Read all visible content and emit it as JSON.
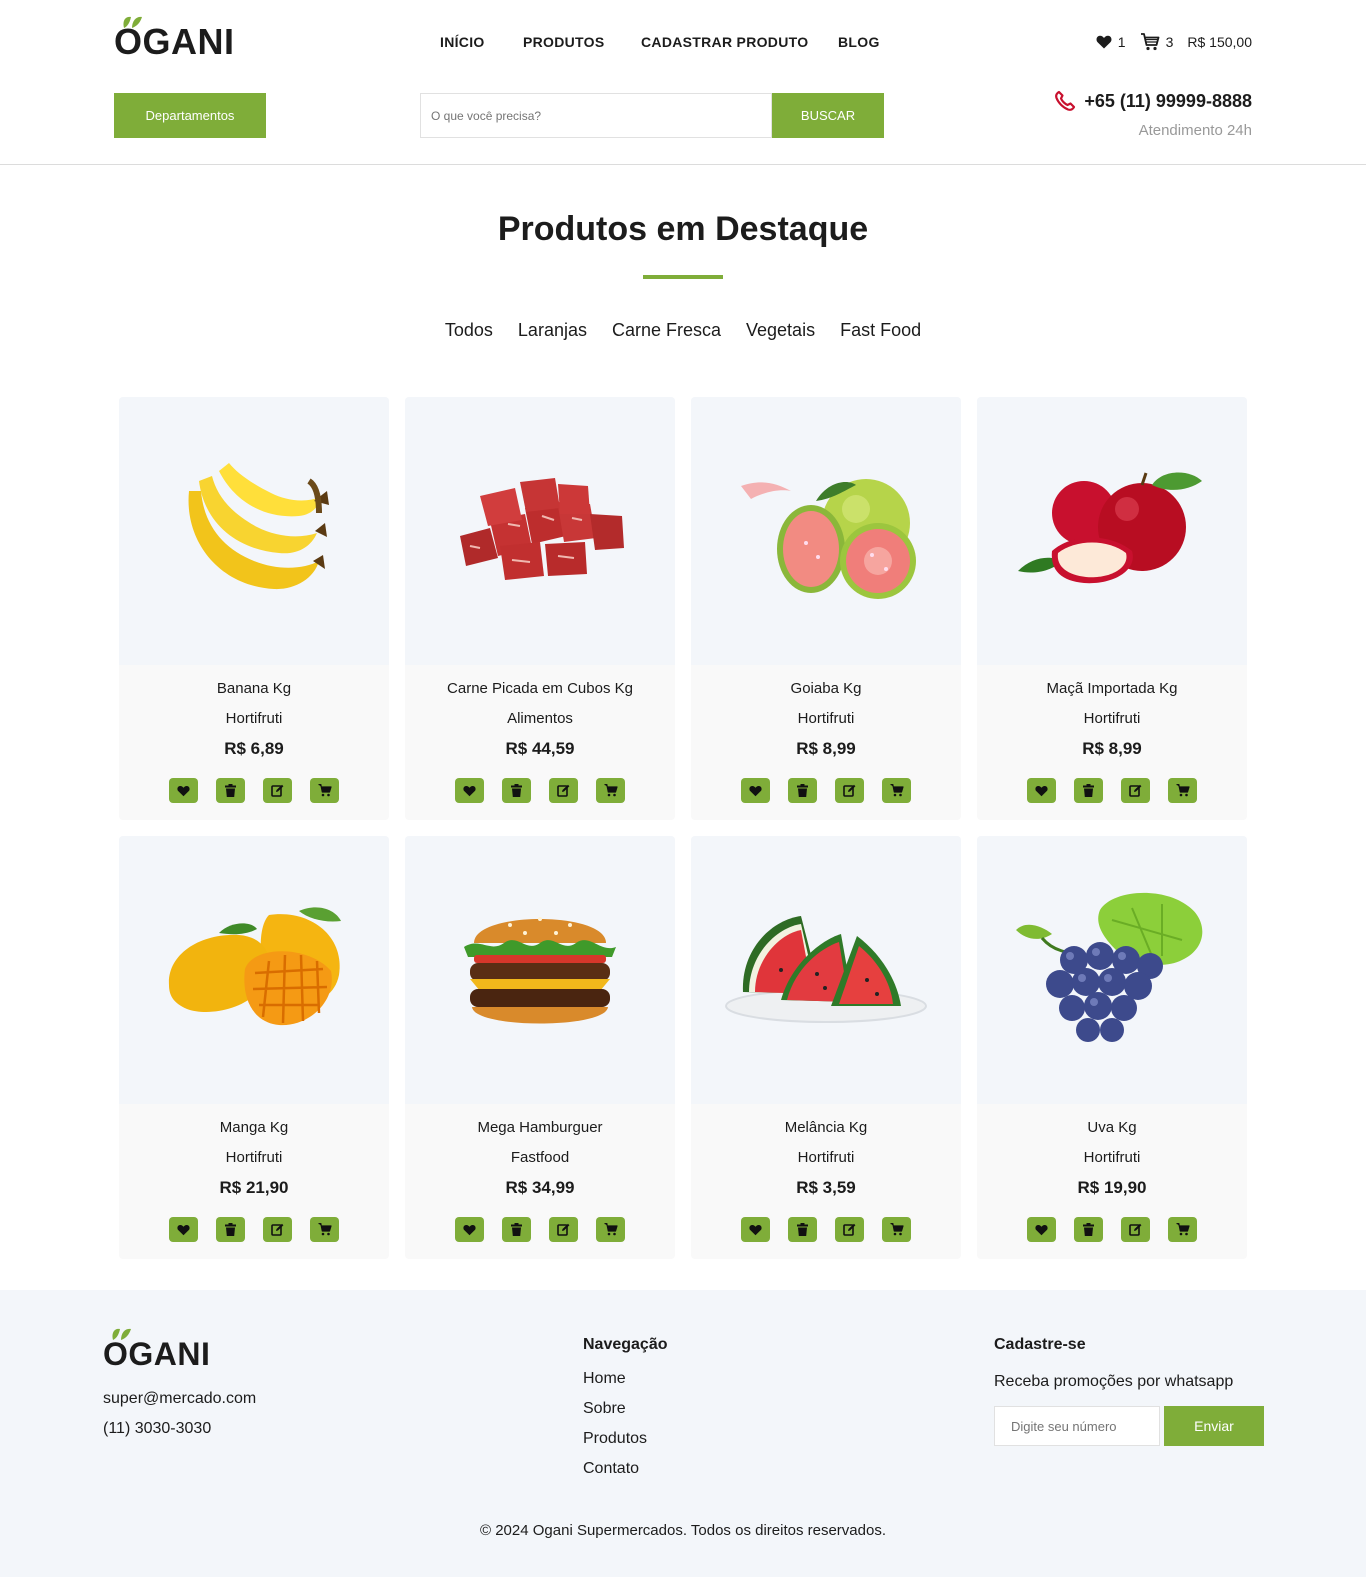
{
  "brand": {
    "name": "OGANI",
    "accent": "#7fad39"
  },
  "nav": [
    {
      "label": "INÍCIO"
    },
    {
      "label": "PRODUTOS"
    },
    {
      "label": "CADASTRAR PRODUTO"
    },
    {
      "label": "BLOG"
    }
  ],
  "header": {
    "wishlist_count": "1",
    "cart_count": "3",
    "cart_total": "R$ 150,00",
    "departments_label": "Departamentos",
    "search_placeholder": "O que você precisa?",
    "search_button": "BUSCAR",
    "phone": "+65 (11) 99999-8888",
    "phone_sub": "Atendimento 24h"
  },
  "featured": {
    "title": "Produtos em Destaque",
    "filters": [
      "Todos",
      "Laranjas",
      "Carne Fresca",
      "Vegetais",
      "Fast Food"
    ]
  },
  "products": [
    {
      "name": "Banana Kg",
      "category": "Hortifruti",
      "price": "R$ 6,89",
      "image": "banana"
    },
    {
      "name": "Carne Picada em Cubos Kg",
      "category": "Alimentos",
      "price": "R$ 44,59",
      "image": "beef-cubes"
    },
    {
      "name": "Goiaba Kg",
      "category": "Hortifruti",
      "price": "R$ 8,99",
      "image": "guava"
    },
    {
      "name": "Maçã Importada Kg",
      "category": "Hortifruti",
      "price": "R$ 8,99",
      "image": "apple"
    },
    {
      "name": "Manga Kg",
      "category": "Hortifruti",
      "price": "R$ 21,90",
      "image": "mango"
    },
    {
      "name": "Mega Hamburguer",
      "category": "Fastfood",
      "price": "R$ 34,99",
      "image": "burger"
    },
    {
      "name": "Melância Kg",
      "category": "Hortifruti",
      "price": "R$ 3,59",
      "image": "watermelon"
    },
    {
      "name": "Uva Kg",
      "category": "Hortifruti",
      "price": "R$ 19,90",
      "image": "grapes"
    }
  ],
  "card_actions": [
    "heart-icon",
    "trash-icon",
    "edit-icon",
    "cart-icon"
  ],
  "footer": {
    "email": "super@mercado.com",
    "phone": "(11) 3030-3030",
    "nav_title": "Navegação",
    "nav_links": [
      "Home",
      "Sobre",
      "Produtos",
      "Contato"
    ],
    "signup_title": "Cadastre-se",
    "signup_text": "Receba promoções por whatsapp",
    "signup_placeholder": "Digite seu número",
    "signup_button": "Enviar",
    "copyright": "© 2024 Ogani Supermercados. Todos os direitos reservados."
  }
}
